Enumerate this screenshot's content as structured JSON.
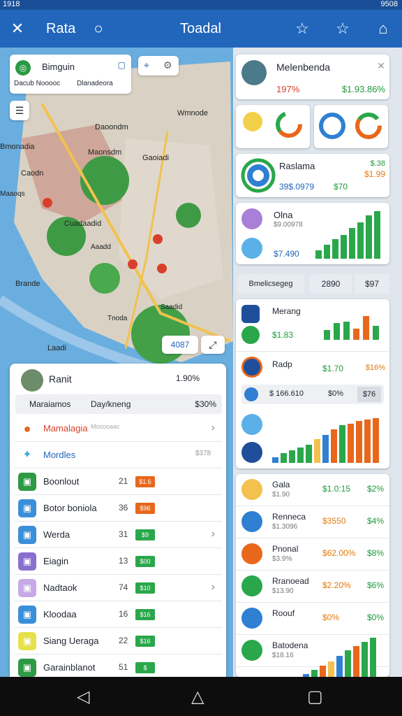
{
  "status": {
    "left": "1918",
    "right": "9508"
  },
  "header": {
    "title_left": "Rata",
    "title_center": "Toadal"
  },
  "map": {
    "card": {
      "title": "Bimguin",
      "chip1": "Dacub Nooooc",
      "chip2": "Dlanadeora"
    },
    "labels": [
      "Wmnode",
      "Daoondm",
      "Maonsdm",
      "Caodn",
      "Gaoiadi",
      "Cuadaadid",
      "Bmonadia",
      "Brande",
      "Laadi",
      "Tnoda",
      "Maaoqs",
      "Aaadd",
      "Saadid"
    ],
    "zoom_btn": "4087"
  },
  "left_panel": {
    "title": "Ranit",
    "value": "1.90%",
    "sub_left": "Maraiamos",
    "sub_mid": "Day/kneng",
    "sub_right": "$30%",
    "featured": [
      {
        "label": "Mamalagia",
        "sub": "Mocooaac"
      },
      {
        "label": "Mordles",
        "value": "$378"
      }
    ],
    "items": [
      {
        "label": "Boonlout",
        "num": "21",
        "badge": "$1.6",
        "color": "#e8671b",
        "icon_bg": "#2f9a44"
      },
      {
        "label": "Botor boniola",
        "num": "36",
        "badge": "$96",
        "color": "#e8671b",
        "icon_bg": "#3b8fd9"
      },
      {
        "label": "Werda",
        "num": "31",
        "badge": "$9",
        "color": "#2aa74a",
        "icon_bg": "#3b8fd9"
      },
      {
        "label": "Eiagin",
        "num": "13",
        "badge": "$00",
        "color": "#2aa74a",
        "icon_bg": "#8a6fd0"
      },
      {
        "label": "Nadtaok",
        "num": "74",
        "badge": "$10",
        "color": "#2aa74a",
        "icon_bg": "#c7a9e8"
      },
      {
        "label": "Kloodaa",
        "num": "16",
        "badge": "$16",
        "color": "#2aa74a",
        "icon_bg": "#3b8fd9"
      },
      {
        "label": "Siang Ueraga",
        "num": "22",
        "badge": "$16",
        "color": "#2aa74a",
        "icon_bg": "#e6e04a"
      },
      {
        "label": "Garainblanot",
        "num": "51",
        "badge": "$",
        "color": "#2aa74a",
        "icon_bg": "#2f9a44"
      }
    ]
  },
  "right_panel": {
    "profile": {
      "name": "Melenbenda",
      "pct": "197%",
      "value": "$1.93.86%"
    },
    "summary": {
      "name": "Raslama",
      "sub": "39$.0979",
      "v1": "$.38",
      "v2": "$1.99",
      "v3": "$70"
    },
    "metric": {
      "name": "Olna",
      "sub": "$9.00978",
      "sub2": "$7.490"
    },
    "filter": {
      "left": "Bmelicsegeg",
      "mid": "2890",
      "right": "$97"
    },
    "group1": [
      {
        "label": "Merang",
        "v1": "$1.83",
        "color": "#e07a10"
      },
      {
        "label": "Radp",
        "v1": "$1.70",
        "v2": "$16%",
        "color": "#1e9a3a"
      },
      {
        "label": "$ 166.610",
        "v1": "$0%",
        "v2": "$76",
        "color": "#333"
      }
    ],
    "group2": [
      {
        "label": "Gala",
        "sub": "$1.90",
        "v1": "$1.0:15",
        "v2": "$2%",
        "c1": "#1e9a3a"
      },
      {
        "label": "Renneca",
        "sub": "$1.3096",
        "v1": "$3550",
        "v2": "$4%",
        "c1": "#e07a10"
      },
      {
        "label": "Pnonal",
        "sub": "$3.9%",
        "v1": "$62.00%",
        "v2": "$8%",
        "c1": "#e07a10"
      },
      {
        "label": "Rranoead",
        "sub": "$13.90",
        "v1": "$2.20%",
        "v2": "$6%",
        "c1": "#e07a10"
      },
      {
        "label": "Roouf",
        "v1": "$0%",
        "v2": "$0%",
        "c1": "#e07a10"
      },
      {
        "label": "Batodena",
        "sub": "$18.16",
        "v1": "",
        "v2": "",
        "c1": "#1e9a3a"
      }
    ]
  },
  "colors": {
    "primary": "#2266bb",
    "green": "#2aa74a",
    "orange": "#e8671b",
    "blue": "#2f7fd3"
  }
}
